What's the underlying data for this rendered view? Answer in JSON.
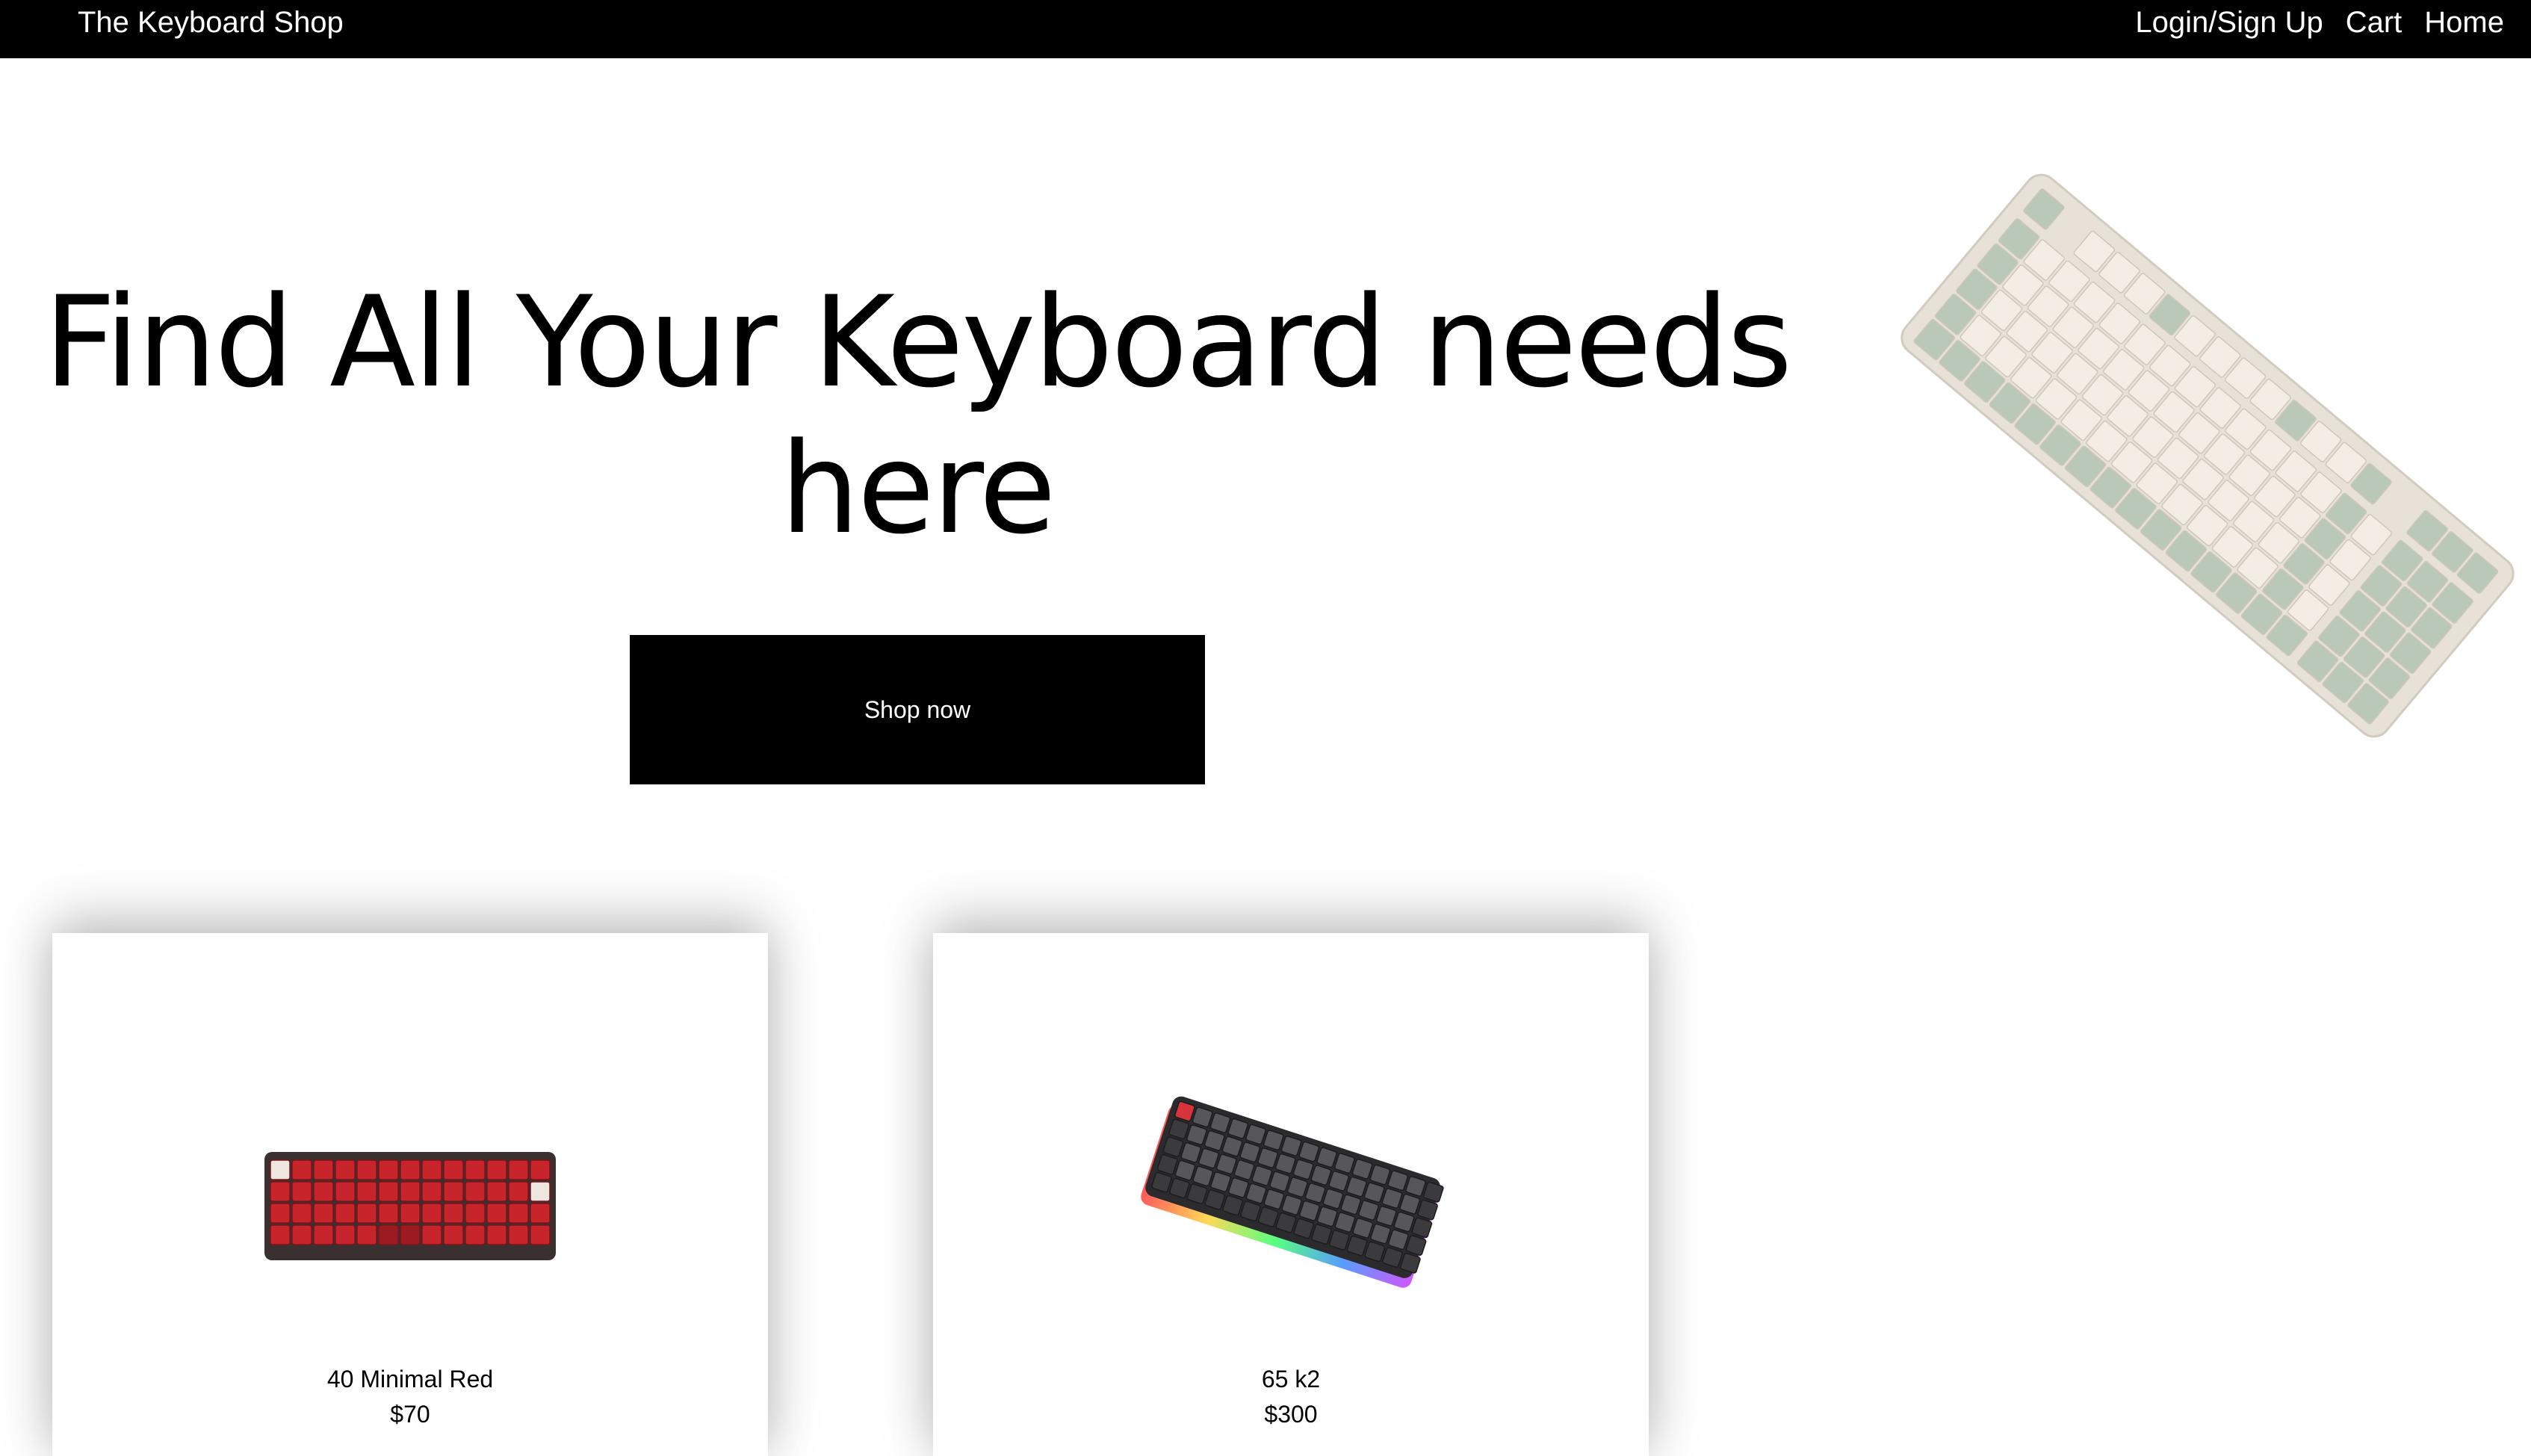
{
  "nav": {
    "brand": "The Keyboard Shop",
    "links": [
      "Login/Sign Up",
      "Cart",
      "Home"
    ]
  },
  "hero": {
    "title": "Find All Your Keyboard needs here",
    "button_label": "Shop now",
    "image_icon": "cream-green-tkl-keyboard-image"
  },
  "products": [
    {
      "name": "40 Minimal Red",
      "price": "$70",
      "image_icon": "red-40-percent-keyboard-image"
    },
    {
      "name": "65 k2",
      "price": "$300",
      "image_icon": "black-65-percent-rgb-keyboard-image"
    }
  ],
  "colors": {
    "nav_background": "#000000",
    "button_background": "#000000",
    "page_background": "#ffffff"
  }
}
